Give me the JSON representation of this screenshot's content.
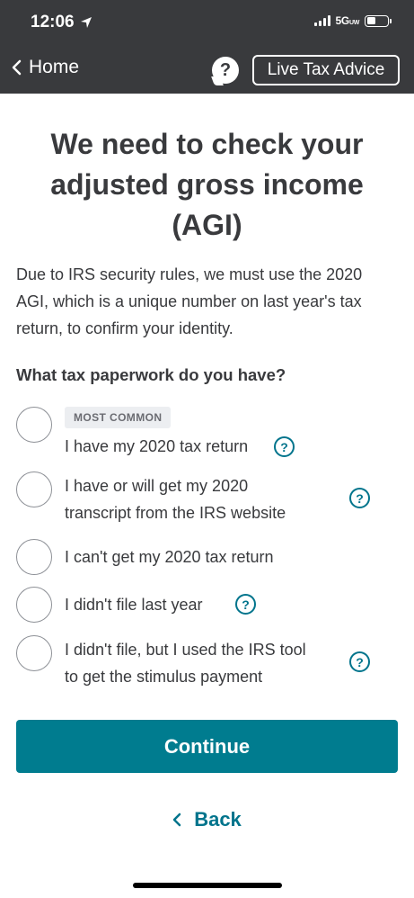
{
  "status_bar": {
    "time": "12:06",
    "network": "5G",
    "network_sub": "UW",
    "battery_level": 0.45
  },
  "nav": {
    "back_label": "Home",
    "help_glyph": "?",
    "live_advice_label": "Live Tax Advice"
  },
  "title": "We need to check your adjusted gross income (AGI)",
  "intro": "Due to IRS security rules, we must use the 2020 AGI, which is a unique number on last year's tax return, to confirm your identity.",
  "question": "What tax paperwork do you have?",
  "options": [
    {
      "badge": "MOST COMMON",
      "label": "I have my 2020 tax return",
      "has_help": true,
      "selected": false
    },
    {
      "label_line1": "I have or will get my 2020",
      "label_line2": "transcript from the IRS website",
      "has_help": true,
      "selected": false
    },
    {
      "label": "I can't get my 2020 tax return",
      "has_help": false,
      "selected": false
    },
    {
      "label": "I didn't file last year",
      "has_help": true,
      "selected": false
    },
    {
      "label_line1": "I didn't file, but I used the IRS tool",
      "label_line2": "to get the stimulus payment",
      "has_help": true,
      "selected": false
    }
  ],
  "help_glyph": "?",
  "buttons": {
    "continue_label": "Continue",
    "back_label": "Back"
  },
  "colors": {
    "header_bg": "#393a3d",
    "accent": "#007c8f",
    "link": "#00748c",
    "text": "#393a3d"
  }
}
